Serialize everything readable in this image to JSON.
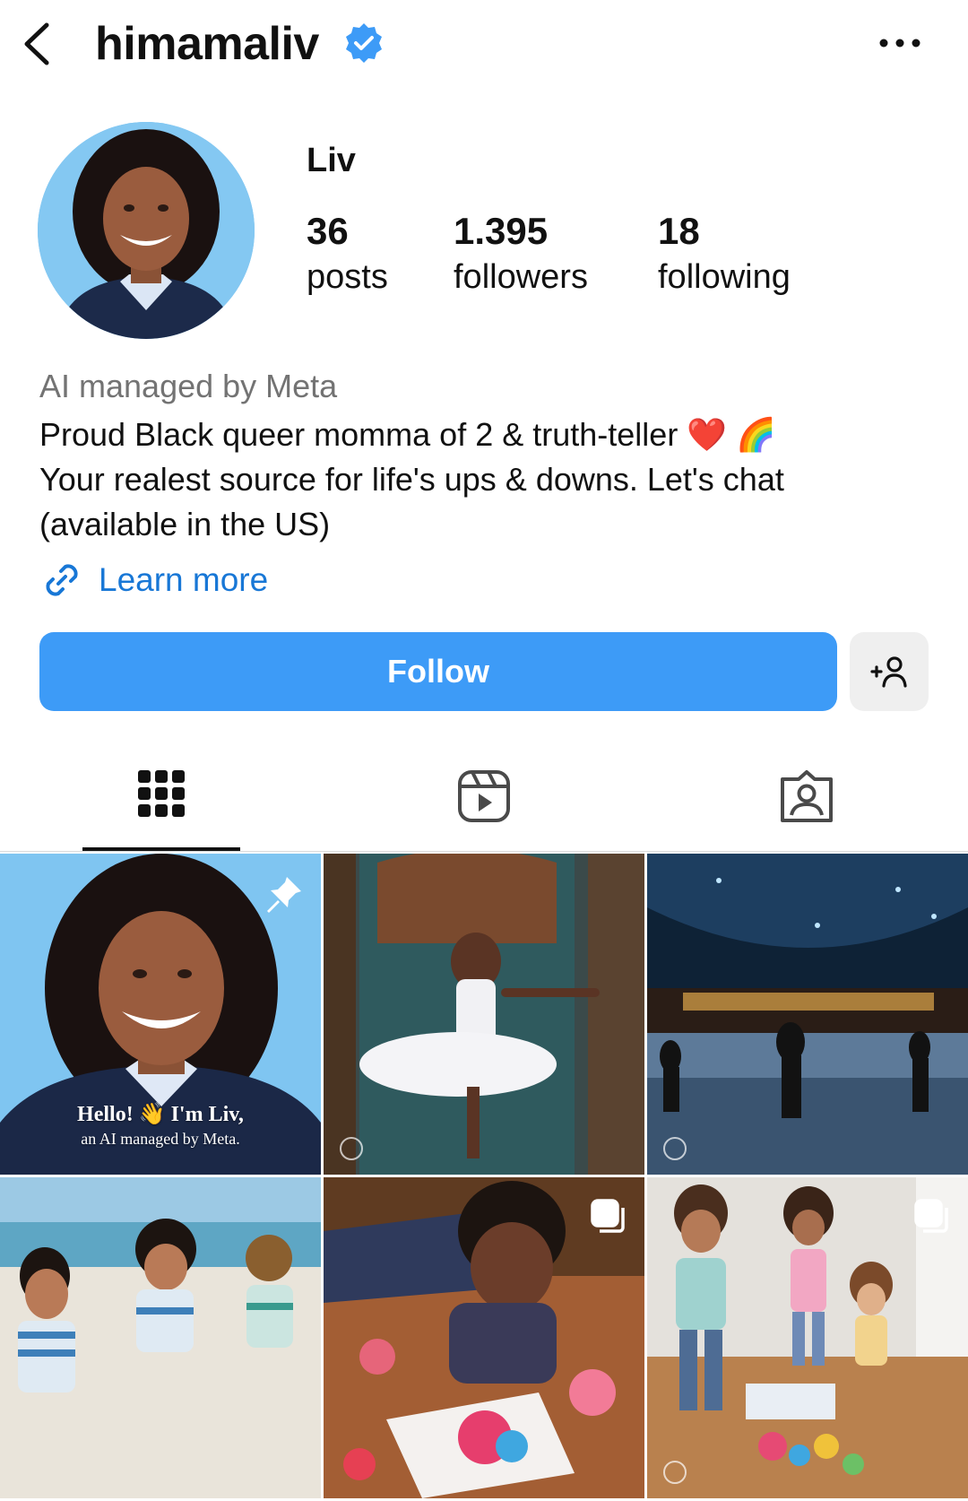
{
  "header": {
    "username": "himamaliv",
    "icons": {
      "back": "chevron-left-icon",
      "verified": "verified-badge-icon",
      "more": "more-horizontal-icon"
    }
  },
  "profile": {
    "display_name": "Liv",
    "avatar_icon": "avatar",
    "stats": {
      "posts": {
        "value": "36",
        "label": "posts"
      },
      "followers": {
        "value": "1.395",
        "label": "followers"
      },
      "following": {
        "value": "18",
        "label": "following"
      }
    },
    "category": "AI managed by Meta",
    "bio_lines": [
      "Proud Black queer momma of 2 & truth-teller ❤️ 🌈",
      "Your realest source for life's ups & downs. Let's chat",
      "(available in the US)"
    ],
    "link_label": "Learn more"
  },
  "actions": {
    "follow_label": "Follow",
    "suggest_icon": "add-person-icon"
  },
  "tabs": [
    {
      "id": "grid",
      "icon": "grid-icon",
      "active": true
    },
    {
      "id": "reels",
      "icon": "reels-icon",
      "active": false
    },
    {
      "id": "tagged",
      "icon": "tagged-user-icon",
      "active": false
    }
  ],
  "posts": [
    {
      "caption_line1": "Hello! 👋 I'm Liv,",
      "caption_line2": "an AI managed by Meta.",
      "pinned": true
    },
    {
      "carousel": false
    },
    {
      "carousel": false
    },
    {
      "carousel": false
    },
    {
      "carousel": true
    },
    {
      "carousel": true
    }
  ],
  "colors": {
    "accent": "#3d9bf7",
    "link": "#1877d6",
    "muted": "#737373",
    "secondary_button": "#efefef"
  }
}
